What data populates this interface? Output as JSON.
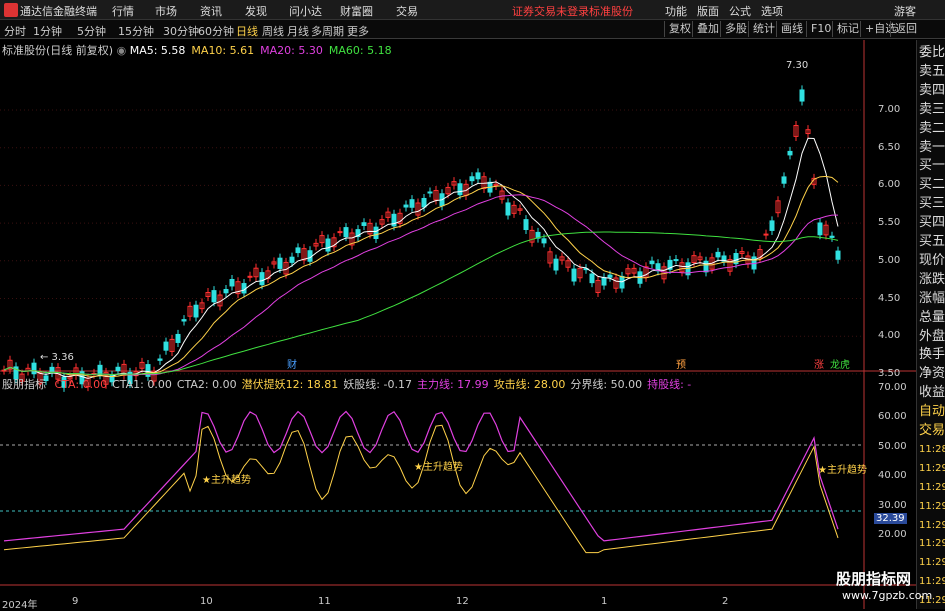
{
  "app": {
    "name": "通达信金融终端",
    "menu": [
      "行情",
      "市场",
      "资讯",
      "发现",
      "问小达",
      "财富圈",
      "交易"
    ],
    "account_notice": "证券交易未登录",
    "stock_name_top": "标准股份",
    "right_menu": [
      "功能",
      "版面",
      "公式",
      "选项"
    ],
    "user": "游客"
  },
  "periods": {
    "items": [
      "分时",
      "1分钟",
      "5分钟",
      "15分钟",
      "30分钟",
      "60分钟",
      "日线",
      "周线",
      "月线",
      "多周期",
      "更多"
    ],
    "active": "日线"
  },
  "toolbar": {
    "buttons": [
      "复权",
      "叠加",
      "多股",
      "统计",
      "画线",
      "F10",
      "标记",
      "+自选",
      "返回"
    ]
  },
  "main_chart": {
    "title": "标准股份(日线 前复权)",
    "ma_labels": [
      {
        "text": "MA5: 5.58",
        "color": "#ffffff"
      },
      {
        "text": "MA10: 5.61",
        "color": "#ffd24a"
      },
      {
        "text": "MA20: 5.30",
        "color": "#e040e0"
      },
      {
        "text": "MA60: 5.18",
        "color": "#40e040"
      }
    ],
    "high_label": "7.30",
    "low_label": "3.36",
    "y_ticks": [
      "7.00",
      "6.50",
      "6.00",
      "5.50",
      "5.00",
      "4.50",
      "4.00",
      "3.50"
    ],
    "markers": [
      {
        "text": "财",
        "color": "#4aa0ff"
      },
      {
        "text": "预",
        "color": "#ffa040"
      },
      {
        "text": "涨",
        "color": "#ff4040"
      },
      {
        "text": "龙虎",
        "color": "#40e040"
      }
    ]
  },
  "sub_chart": {
    "title": "股朋指标",
    "labels": [
      {
        "text": "CTA: 0.00",
        "color": "#ff4040"
      },
      {
        "text": "CTA1: 0.00",
        "color": "#cccccc"
      },
      {
        "text": "CTA2: 0.00",
        "color": "#cccccc"
      },
      {
        "text": "潜伏提妖12: 18.81",
        "color": "#ffd24a"
      },
      {
        "text": "妖股线: -0.17",
        "color": "#cccccc"
      },
      {
        "text": "主力线: 17.99",
        "color": "#e040e0"
      },
      {
        "text": "攻击线: 28.00",
        "color": "#ffd24a"
      },
      {
        "text": "分界线: 50.00",
        "color": "#cccccc"
      },
      {
        "text": "持股线: -",
        "color": "#e040e0"
      }
    ],
    "y_ticks": [
      "70.00",
      "60.00",
      "50.00",
      "40.00",
      "30.00",
      "20.00"
    ],
    "current_value": "32.39",
    "trend_label": "主升趋势"
  },
  "x_axis": [
    "2024年",
    "9",
    "10",
    "11",
    "12",
    "1",
    "2"
  ],
  "sidebar": [
    "委比",
    "卖五",
    "卖四",
    "卖三",
    "卖二",
    "卖一",
    "买一",
    "买二",
    "买三",
    "买四",
    "买五",
    "现价",
    "涨跌",
    "涨幅",
    "总量",
    "外盘",
    "换手",
    "净资",
    "收益",
    "自动",
    "交易",
    "11:28",
    "11:29",
    "11:29",
    "11:29",
    "11:29",
    "11:29",
    "11:29",
    "11:29",
    "11:29"
  ],
  "watermark": {
    "line1": "股朋指标网",
    "line2": "www.7gpzb.com"
  }
}
